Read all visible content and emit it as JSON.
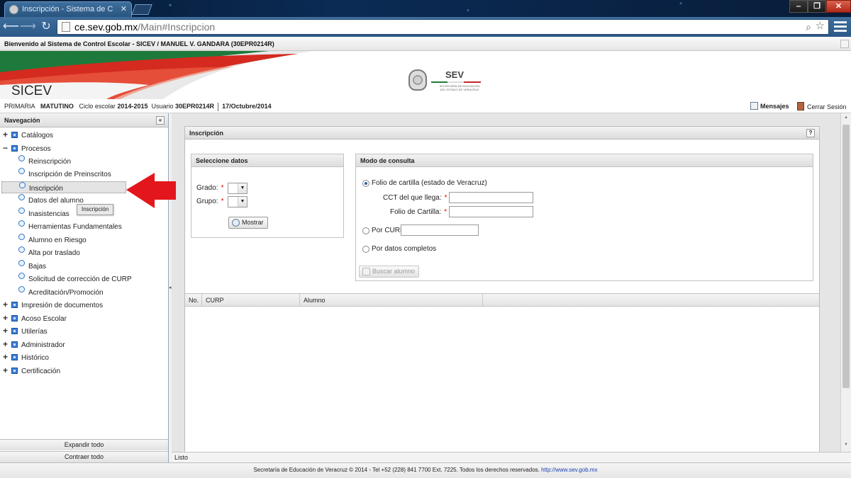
{
  "browser": {
    "tab_title": "Inscripción - Sistema de C",
    "url_host": "ce.sev.gob.mx",
    "url_path": "/Main#Inscripcion"
  },
  "header": {
    "welcome": "Bienvenido al Sistema de Control Escolar - SICEV / MANUEL V. GANDARA (30EPR0214R)",
    "app_name": "SICEV",
    "logo_text": "SEV",
    "logo_subtext": "SECRETARÍA DE EDUCACIÓN DEL ESTADO DE VERACRUZ"
  },
  "infobar": {
    "nivel": "PRIMARIA",
    "turno": "MATUTINO",
    "ciclo_label": "Ciclo escolar",
    "ciclo_value": "2014-2015",
    "usuario_label": "Usuario",
    "usuario_value": "30EPR0214R",
    "fecha": "17/Octubre/2014",
    "mensajes": "Mensajes",
    "cerrar": "Cerrar Sesión"
  },
  "sidebar": {
    "title": "Navegación",
    "collapse_glyph": "«",
    "items": [
      {
        "label": "Catálogos",
        "sign": "+"
      },
      {
        "label": "Procesos",
        "sign": "−"
      },
      {
        "label": "Reinscripción"
      },
      {
        "label": "Inscripción de Preinscritos"
      },
      {
        "label": "Inscripción"
      },
      {
        "label": "Datos del alumno"
      },
      {
        "label": "Inasistencias"
      },
      {
        "label": "Herramientas Fundamentales"
      },
      {
        "label": "Alumno en Riesgo"
      },
      {
        "label": "Alta por traslado"
      },
      {
        "label": "Bajas"
      },
      {
        "label": "Solicitud de corrección de CURP"
      },
      {
        "label": "Acreditación/Promoción"
      },
      {
        "label": "Impresión de documentos",
        "sign": "+"
      },
      {
        "label": "Acoso Escolar",
        "sign": "+"
      },
      {
        "label": "Utilerías",
        "sign": "+"
      },
      {
        "label": "Administrador",
        "sign": "+"
      },
      {
        "label": "Histórico",
        "sign": "+"
      },
      {
        "label": "Certificación",
        "sign": "+"
      }
    ],
    "tooltip": "Inscripción",
    "expand_all": "Expandir todo",
    "collapse_all": "Contraer todo"
  },
  "main": {
    "panel_title": "Inscripción",
    "help": "?",
    "seleccione": {
      "title": "Seleccione datos",
      "grado_label": "Grado:",
      "grupo_label": "Grupo:",
      "required": "*",
      "mostrar": "Mostrar"
    },
    "modo": {
      "title": "Modo de consulta",
      "opt_folio": "Folio de cartilla (estado de Veracruz)",
      "cct_label": "CCT del que llega:",
      "folio_label": "Folio de Cartilla:",
      "opt_curp": "Por CURP",
      "opt_datos": "Por datos completos",
      "buscar": "Buscar alumno",
      "selected": "folio"
    },
    "grid": {
      "columns": [
        "No.",
        "CURP",
        "Alumno"
      ]
    },
    "status": "Listo"
  },
  "footer": {
    "text": "Secretaría de Educación de Veracruz © 2014 - Tel +52 (228) 841 7700 Ext. 7225. Todos los derechos reservados.",
    "link": "http://www.sev.gob.mx"
  },
  "colors": {
    "banner_green": "#1e7a3c",
    "banner_red": "#d42a20",
    "arrow_red": "#e3161c",
    "chrome_blue": "#2c5987"
  }
}
